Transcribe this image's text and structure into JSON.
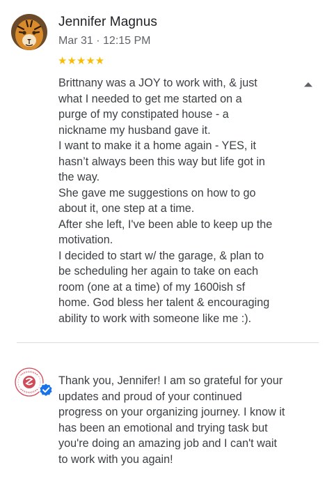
{
  "review": {
    "reviewer_name": "Jennifer Magnus",
    "date": "Mar 31 · 12:15 PM",
    "rating": 5,
    "stars": "★★★★★",
    "body_lines": [
      "Brittnany was a JOY to work with, & just",
      "what I needed to get me started on a",
      "purge of my constipated house - a",
      "nickname my husband gave it.",
      "I want to make it a home again - YES, it",
      "hasn’t always been this way but life got in",
      "the way.",
      "She gave me suggestions on how to go",
      "about it, one step at a time.",
      "After she left, I've been able to keep up the",
      "motivation.",
      "I decided to start w/ the garage, & plan to",
      "be scheduling her again to take on each",
      "room (one at a time) of my 1600ish sf",
      "home. God bless her talent & encouraging",
      "ability to work with someone like me :)."
    ],
    "collapse_icon": "chevron-up-icon"
  },
  "owner_response": {
    "verified_icon": "verified-check-icon",
    "body_lines": [
      "Thank you, Jennifer! I am so grateful for your",
      "updates and proud of your continued",
      "progress on your organizing journey. I know it",
      "has been an emotional and trying task but",
      "you're doing an amazing job and I can't wait",
      "to work with you again!"
    ]
  },
  "colors": {
    "star": "#fbbc04",
    "verified": "#1a73e8",
    "logo": "#d04a5a"
  }
}
